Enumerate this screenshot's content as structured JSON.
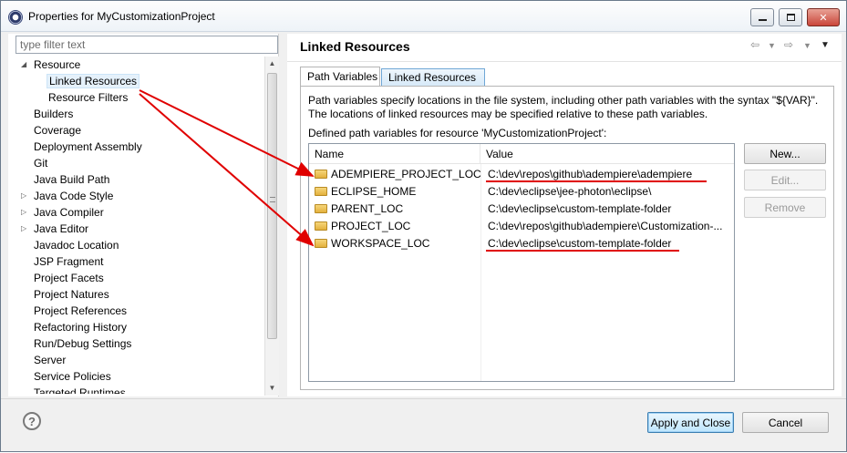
{
  "window": {
    "title": "Properties for MyCustomizationProject"
  },
  "filter": {
    "placeholder": "type filter text"
  },
  "tree": [
    {
      "label": "Resource",
      "expanded": true,
      "twisty": "◢"
    },
    {
      "label": "Linked Resources",
      "selected": true
    },
    {
      "label": "Resource Filters"
    },
    {
      "label": "Builders"
    },
    {
      "label": "Coverage"
    },
    {
      "label": "Deployment Assembly"
    },
    {
      "label": "Git"
    },
    {
      "label": "Java Build Path"
    },
    {
      "label": "Java Code Style",
      "twisty": "▷"
    },
    {
      "label": "Java Compiler",
      "twisty": "▷"
    },
    {
      "label": "Java Editor",
      "twisty": "▷"
    },
    {
      "label": "Javadoc Location"
    },
    {
      "label": "JSP Fragment"
    },
    {
      "label": "Project Facets"
    },
    {
      "label": "Project Natures"
    },
    {
      "label": "Project References"
    },
    {
      "label": "Refactoring History"
    },
    {
      "label": "Run/Debug Settings"
    },
    {
      "label": "Server"
    },
    {
      "label": "Service Policies"
    },
    {
      "label": "Targeted Runtimes"
    }
  ],
  "page": {
    "title": "Linked Resources",
    "tabs": [
      "Path Variables",
      "Linked Resources"
    ],
    "description": "Path variables specify locations in the file system, including other path variables with the syntax \"${VAR}\". The locations of linked resources may be specified relative to these path variables.",
    "defined_label": "Defined path variables for resource 'MyCustomizationProject':",
    "columns": {
      "name": "Name",
      "value": "Value"
    },
    "rows": [
      {
        "name": "ADEMPIERE_PROJECT_LOC",
        "value": "C:\\dev\\repos\\github\\adempiere\\adempiere"
      },
      {
        "name": "ECLIPSE_HOME",
        "value": "C:\\dev\\eclipse\\jee-photon\\eclipse\\"
      },
      {
        "name": "PARENT_LOC",
        "value": "C:\\dev\\eclipse\\custom-template-folder"
      },
      {
        "name": "PROJECT_LOC",
        "value": "C:\\dev\\repos\\github\\adempiere\\Customization-..."
      },
      {
        "name": "WORKSPACE_LOC",
        "value": "C:\\dev\\eclipse\\custom-template-folder"
      }
    ],
    "buttons": {
      "new": "New...",
      "edit": "Edit...",
      "remove": "Remove"
    }
  },
  "footer": {
    "help": "?",
    "apply_close": "Apply and Close",
    "cancel": "Cancel"
  },
  "colors": {
    "annotation": "#e00000",
    "selection": "#e5f1fb",
    "default_button": "#bee6fd"
  },
  "icons": [
    "eclipse-app-icon",
    "minimize-icon",
    "maximize-icon",
    "close-icon",
    "back-arrow-icon",
    "forward-arrow-icon",
    "dropdown-icon",
    "folder-icon",
    "help-icon"
  ]
}
